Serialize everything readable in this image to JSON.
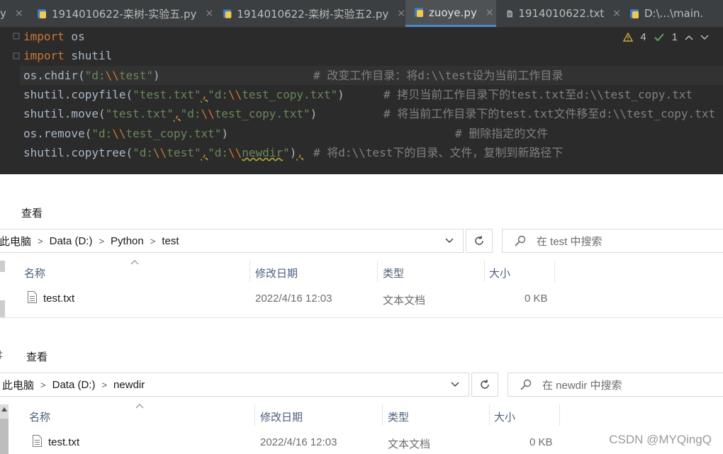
{
  "ide": {
    "tabs": [
      {
        "label": "y",
        "icon": "none",
        "active": false
      },
      {
        "label": "1914010622-栾树-实验五.py",
        "icon": "python-file-icon",
        "active": false
      },
      {
        "label": "1914010622-栾树-实验五2.py",
        "icon": "python-file-icon",
        "active": false
      },
      {
        "label": "zuoye.py",
        "icon": "python-file-icon",
        "active": true
      },
      {
        "label": "1914010622.txt",
        "icon": "text-file-icon",
        "active": false
      },
      {
        "label": "D:\\...\\main.",
        "icon": "python-file-icon",
        "active": false
      }
    ],
    "close_glyph": "×",
    "inspections": {
      "warnings": "4",
      "weak_warnings": "1"
    },
    "code": {
      "line1": {
        "kw": "import",
        "rest": " os"
      },
      "line2": {
        "kw": "import",
        "rest": " shutil"
      },
      "line3": {
        "call": "os.chdir(",
        "s1": "\"d:",
        "e1": "\\\\",
        "s2": "test\"",
        "close": ")",
        "comment": "# 改变工作目录：将d:\\\\test设为当前工作目录"
      },
      "line4": {
        "call": "shutil.copyfile(",
        "a1": "\"test.txt\"",
        "comma": ",",
        "b1": "\"d:",
        "be": "\\\\",
        "b2": "test_copy.txt\"",
        "close": ")",
        "comment": "# 拷贝当前工作目录下的test.txt至d:\\\\test_copy.txt"
      },
      "line5": {
        "call": "shutil.move(",
        "a1": "\"test.txt\"",
        "comma": ",",
        "b1": "\"d:",
        "be": "\\\\",
        "b2": "test_copy.txt\"",
        "close": ")",
        "comment": "# 将当前工作目录下的test.txt文件移至d:\\\\test_copy.txt"
      },
      "line6": {
        "call": "os.remove(",
        "s1": "\"d:",
        "e1": "\\\\",
        "s2": "test_copy.txt\"",
        "close": ")",
        "comment": "# 删除指定的文件"
      },
      "line7": {
        "call": "shutil.copytree(",
        "a1": "\"d:",
        "ae": "\\\\",
        "a2": "test\"",
        "comma": ",",
        "b1": "\"d:",
        "be": "\\\\",
        "b2": "newdir",
        "b3": "\"",
        "close": ")",
        "comma2": ",",
        "comment": "# 将d:\\\\test下的目录、文件，复制到新路径下"
      }
    }
  },
  "explorer1": {
    "ribbon_tab": "查看",
    "breadcrumb": [
      "此电脑",
      "Data (D:)",
      "Python",
      "test"
    ],
    "search_placeholder": "在 test 中搜索",
    "columns": {
      "name": "名称",
      "modified": "修改日期",
      "type": "类型",
      "size": "大小"
    },
    "rows": [
      {
        "name": "test.txt",
        "modified": "2022/4/16 12:03",
        "type": "文本文档",
        "size": "0 KB"
      }
    ]
  },
  "explorer2": {
    "ribbon_tab_partial": "‡",
    "ribbon_tab": "查看",
    "breadcrumb": [
      "此电脑",
      "Data (D:)",
      "newdir"
    ],
    "search_placeholder": "在 newdir 中搜索",
    "columns": {
      "name": "名称",
      "modified": "修改日期",
      "type": "类型",
      "size": "大小"
    },
    "rows": [
      {
        "name": "test.txt",
        "modified": "2022/4/16 12:03",
        "type": "文本文档",
        "size": "0 KB"
      }
    ]
  },
  "watermark": "CSDN @MYQingQ"
}
